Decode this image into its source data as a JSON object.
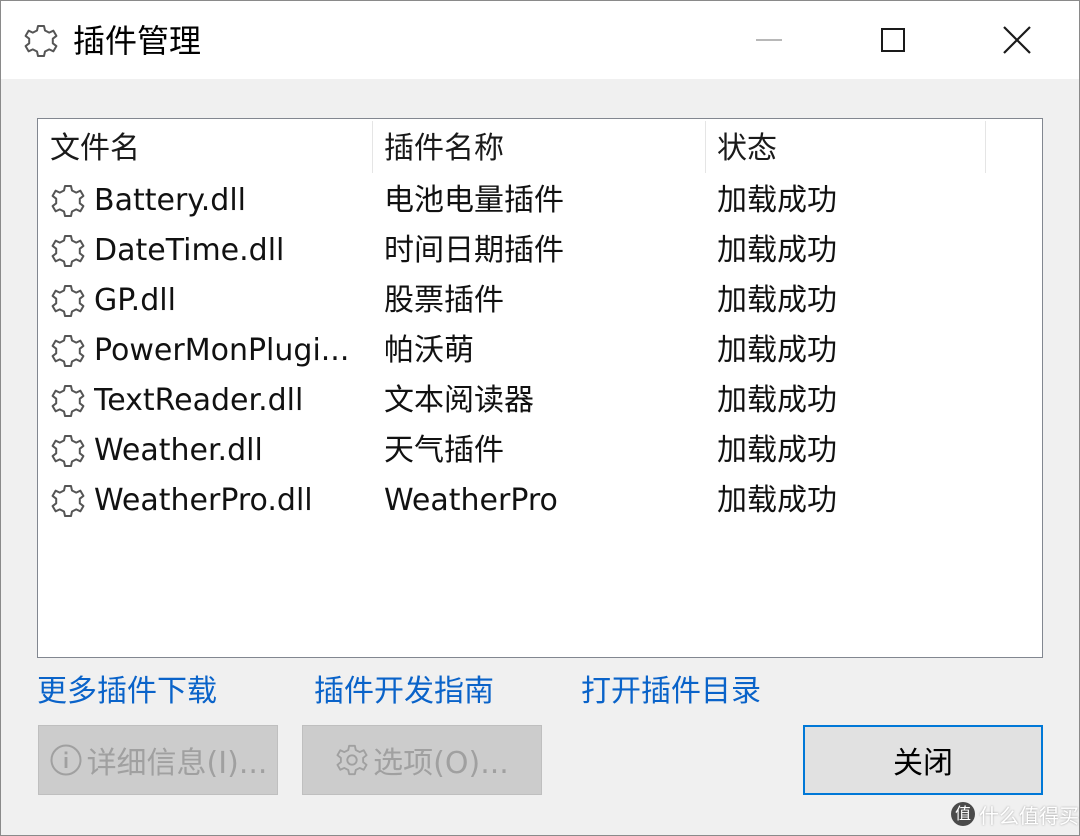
{
  "window": {
    "title": "插件管理",
    "title_icon": "gear-icon",
    "controls": {
      "minimize_icon": "minimize-icon",
      "maximize_icon": "maximize-icon",
      "close_icon": "close-icon"
    }
  },
  "list": {
    "columns": [
      "文件名",
      "插件名称",
      "状态"
    ],
    "row_icon": "gear-icon",
    "rows": [
      {
        "file": "Battery.dll",
        "name": "电池电量插件",
        "status": "加载成功"
      },
      {
        "file": "DateTime.dll",
        "name": "时间日期插件",
        "status": "加载成功"
      },
      {
        "file": "GP.dll",
        "name": "股票插件",
        "status": "加载成功"
      },
      {
        "file": "PowerMonPlugi...",
        "name": "帕沃萌",
        "status": "加载成功"
      },
      {
        "file": "TextReader.dll",
        "name": "文本阅读器",
        "status": "加载成功"
      },
      {
        "file": "Weather.dll",
        "name": "天气插件",
        "status": "加载成功"
      },
      {
        "file": "WeatherPro.dll",
        "name": "WeatherPro",
        "status": "加载成功"
      }
    ]
  },
  "links": {
    "download_more": "更多插件下载",
    "dev_guide": "插件开发指南",
    "open_dir": "打开插件目录"
  },
  "buttons": {
    "details": "详细信息(I)...",
    "options": "选项(O)...",
    "close": "关闭"
  },
  "watermark": {
    "badge": "值",
    "text": "什么值得买"
  },
  "colors": {
    "link": "#0a63c9",
    "focus_border": "#0078d7",
    "disabled_text": "#a0a0a0"
  }
}
